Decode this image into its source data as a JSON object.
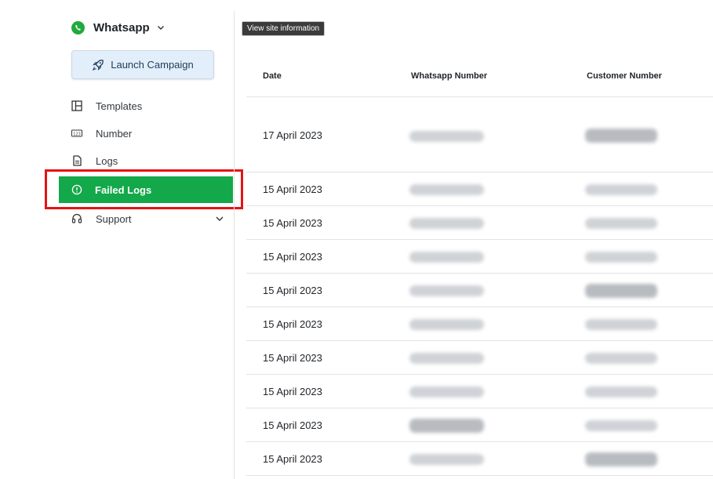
{
  "app": {
    "title": "Whatsapp",
    "accent": "#13a84a",
    "brand_icon": "whatsapp-icon"
  },
  "sidebar": {
    "launch_label": "Launch Campaign",
    "items": [
      {
        "label": "Templates",
        "icon": "layout-grid-icon"
      },
      {
        "label": "Number",
        "icon": "number-123-icon"
      },
      {
        "label": "Logs",
        "icon": "document-icon"
      },
      {
        "label": "Failed Logs",
        "icon": "alert-circle-icon",
        "active": true
      },
      {
        "label": "Support",
        "icon": "headset-icon"
      }
    ]
  },
  "tooltip": "View site information",
  "table": {
    "columns": [
      "Date",
      "Whatsapp Number",
      "Customer Number"
    ],
    "rows": [
      {
        "date": "17 April 2023"
      },
      {
        "date": "15 April 2023"
      },
      {
        "date": "15 April 2023"
      },
      {
        "date": "15 April 2023"
      },
      {
        "date": "15 April 2023"
      },
      {
        "date": "15 April 2023"
      },
      {
        "date": "15 April 2023"
      },
      {
        "date": "15 April 2023"
      },
      {
        "date": "15 April 2023"
      },
      {
        "date": "15 April 2023"
      }
    ]
  }
}
